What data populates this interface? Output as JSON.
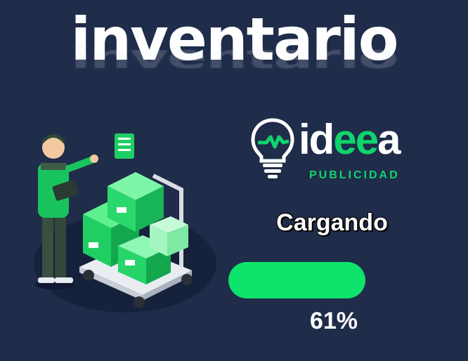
{
  "header": {
    "title": "inventario"
  },
  "brand": {
    "name_white_1": "id",
    "name_green": "ee",
    "name_white_2": "a",
    "subtitle": "PUBLICIDAD",
    "icon": "lightbulb-icon",
    "accent_color": "#10d56b"
  },
  "loader": {
    "label": "Cargando",
    "progress": 0.61,
    "progress_text": "61%",
    "fill_color": "#0ee36b"
  },
  "illustration": {
    "icon": "warehouse-worker-boxes-illustration"
  },
  "colors": {
    "background": "#1f2c4a",
    "text": "#ffffff"
  }
}
